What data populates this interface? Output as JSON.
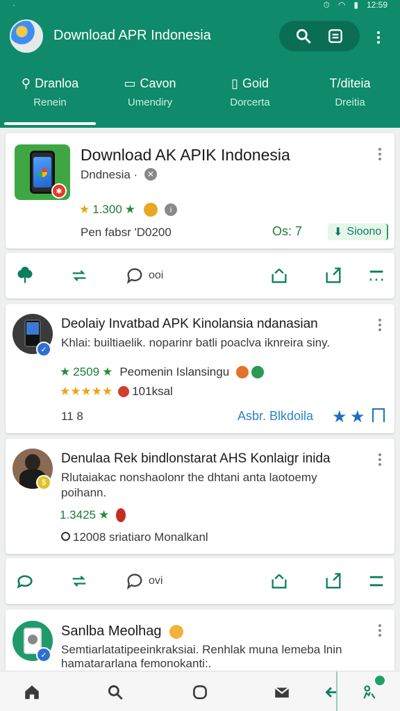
{
  "status": {
    "time": "12:59",
    "left": "·"
  },
  "header": {
    "title": "Download APR Indonesia"
  },
  "tabs": [
    {
      "label": "Dranloa",
      "sub": "Renein"
    },
    {
      "label": "Cavon",
      "sub": "Umendiry"
    },
    {
      "label": "Goid",
      "sub": "Dorcerta"
    },
    {
      "label": "T/diteia",
      "sub": "Dreitia"
    }
  ],
  "cards": [
    {
      "title": "Download AK APIK Indonesia",
      "publisher": "Dndnesia ·",
      "rating": "1.300",
      "meta": "Pen fabsr 'D0200",
      "version": "Os: 7",
      "install_label": "Sioono"
    },
    {
      "title": "Deolaiy Invatbad APK Kinolansia ndanasian",
      "desc": "Khlai: builtiaelik. noparinr batli poaclva iknreira siny.",
      "rating": "2509",
      "tags": "Peomenin Islansingu",
      "rating2": "101ksal",
      "count": "11 8",
      "link": "Asbr. Blkdoila"
    },
    {
      "title": "Denulaa Rek bindlonstarat AHS Konlaigr inida",
      "desc_line1": "Rlutaiakac nonshaolonr the dhtani anta laotoemy",
      "desc_line2": "poihann.",
      "rating": "1.3425",
      "meta": "12008 sriatiaro Monalkanl"
    },
    {
      "title": "Sanlba Meolhag",
      "desc_line1": "Semtiarlatatipeeinkraksiai. Renhlak muna lemeba lnin",
      "desc_line2": "hamatararlana femonokanti:."
    }
  ],
  "actions": {
    "comment_count_1": "ooi",
    "comment_count_2": "ovi"
  },
  "colors": {
    "primary": "#0f8a6a",
    "accent": "#0d7d60",
    "link": "#2b84c8"
  },
  "icons": [
    "search-icon",
    "bookmark-icon",
    "more-icon",
    "home-icon",
    "chat-icon",
    "mail-icon",
    "back-icon"
  ]
}
